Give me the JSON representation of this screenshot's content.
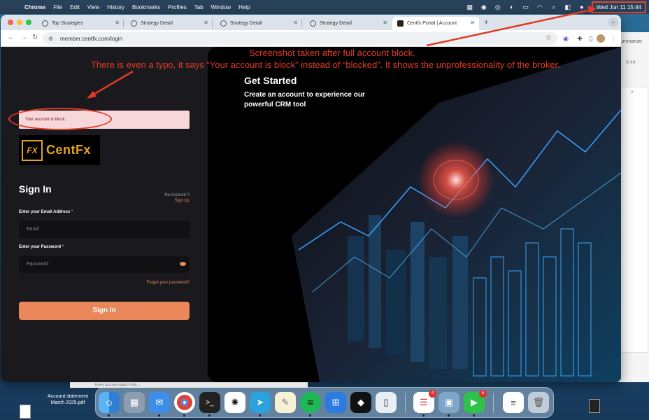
{
  "menubar": {
    "app": "Chrome",
    "items": [
      "File",
      "Edit",
      "View",
      "History",
      "Bookmarks",
      "Profiles",
      "Tab",
      "Window",
      "Help"
    ],
    "clock": "Wed Jun 11  15:44"
  },
  "background_window": {
    "summarize_label": "ummarize",
    "value": "9:44",
    "close": "×"
  },
  "browser": {
    "tabs": [
      {
        "title": "Top Strategies",
        "active": false
      },
      {
        "title": "Strategy Detail",
        "active": false
      },
      {
        "title": "Strategy Detail",
        "active": false
      },
      {
        "title": "Strategy Detail",
        "active": false
      },
      {
        "title": "Centfx Portal | Account",
        "active": true
      }
    ],
    "url": "member.centfx.com/login"
  },
  "login": {
    "alert": "Your account is block.",
    "logo_mark": "FX",
    "logo_word": "CentFx",
    "heading": "Sign In",
    "no_account": "No Account ?",
    "sign_up": "Sign Up",
    "email_label": "Enter your Email Address",
    "email_placeholder": "Email",
    "password_label": "Enter your Password",
    "password_placeholder": "Password",
    "required_mark": "*",
    "forgot": "Forgot your password?",
    "submit": "Sign In"
  },
  "hero": {
    "title": "Get Started",
    "subtitle": "Create an account to experience our powerful CRM tool"
  },
  "annotations": {
    "line1": "Screenshot taken after full account block.",
    "line2": "There is even a typo, it says “Your account is block” instead of “blocked”. It shows the unprofessionality of the broker."
  },
  "desktop": {
    "file_label_1": "Account statement",
    "file_label_2": "March 2025.pdf",
    "finder_text": "Every account equity in the ...",
    "accent_color": "#e9875a",
    "annotation_color": "#e23a25"
  },
  "dock": {
    "apps": [
      {
        "name": "finder",
        "badge": ""
      },
      {
        "name": "launchpad",
        "badge": ""
      },
      {
        "name": "mail",
        "badge": ""
      },
      {
        "name": "chrome",
        "badge": ""
      },
      {
        "name": "terminal",
        "badge": ""
      },
      {
        "name": "chatgpt",
        "badge": ""
      },
      {
        "name": "telegram",
        "badge": ""
      },
      {
        "name": "notes",
        "badge": ""
      },
      {
        "name": "spotify",
        "badge": ""
      },
      {
        "name": "windows-app",
        "badge": ""
      },
      {
        "name": "box-app",
        "badge": ""
      },
      {
        "name": "iphone-mirroring",
        "badge": ""
      },
      {
        "name": "reminders",
        "badge": "4"
      },
      {
        "name": "preview",
        "badge": ""
      },
      {
        "name": "facetime",
        "badge": "5"
      },
      {
        "name": "document",
        "badge": ""
      },
      {
        "name": "trash",
        "badge": ""
      }
    ]
  }
}
